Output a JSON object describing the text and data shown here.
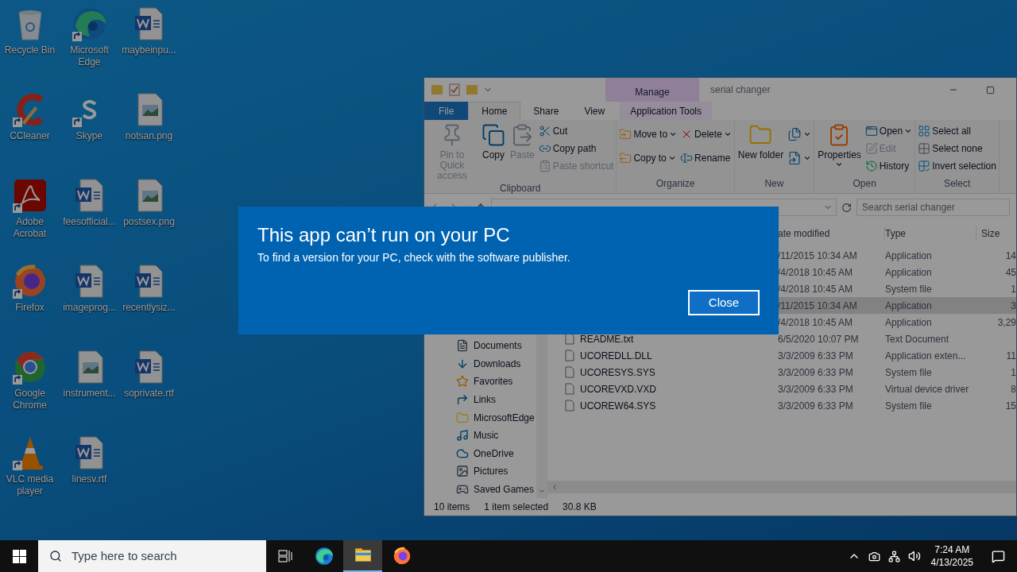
{
  "desktop": {
    "icons": [
      {
        "label": "Recycle Bin",
        "kind": "recycle",
        "shortcut": false
      },
      {
        "label": "CCleaner",
        "kind": "ccleaner",
        "shortcut": true
      },
      {
        "label": "Adobe Acrobat",
        "kind": "acrobat",
        "shortcut": true
      },
      {
        "label": "Firefox",
        "kind": "firefox",
        "shortcut": true
      },
      {
        "label": "Google Chrome",
        "kind": "chrome",
        "shortcut": true
      },
      {
        "label": "VLC media player",
        "kind": "vlc",
        "shortcut": true
      },
      {
        "label": "Microsoft Edge",
        "kind": "edge",
        "shortcut": true
      },
      {
        "label": "Skype",
        "kind": "skype",
        "shortcut": true
      },
      {
        "label": "feesofficial...",
        "kind": "word",
        "shortcut": false
      },
      {
        "label": "imageprog...",
        "kind": "word",
        "shortcut": false
      },
      {
        "label": "instrument...",
        "kind": "image",
        "shortcut": false
      },
      {
        "label": "linesv.rtf",
        "kind": "word",
        "shortcut": false
      },
      {
        "label": "maybeinpu...",
        "kind": "word",
        "shortcut": false
      },
      {
        "label": "notsan.png",
        "kind": "image",
        "shortcut": false
      },
      {
        "label": "postsex.png",
        "kind": "image",
        "shortcut": false
      },
      {
        "label": "recentlysiz...",
        "kind": "word",
        "shortcut": false
      },
      {
        "label": "soprivate.rtf",
        "kind": "word",
        "shortcut": false
      }
    ]
  },
  "explorer": {
    "context_tab": "Manage",
    "title": "serial changer",
    "tabs": [
      {
        "label": "File",
        "kind": "file",
        "selected": false
      },
      {
        "label": "Home",
        "kind": "tab",
        "selected": true
      },
      {
        "label": "Share",
        "kind": "tab",
        "selected": false
      },
      {
        "label": "View",
        "kind": "tab",
        "selected": false
      },
      {
        "label": "Application Tools",
        "kind": "context",
        "selected": false
      }
    ],
    "ribbon": [
      {
        "label": "Clipboard",
        "items": [
          {
            "kind": "large",
            "label": "Pin to Quick access",
            "disabled": true,
            "dropdown": false
          },
          {
            "kind": "large",
            "label": "Copy",
            "disabled": false,
            "dropdown": false
          },
          {
            "kind": "large",
            "label": "Paste",
            "disabled": true,
            "dropdown": false
          },
          {
            "kind": "stack",
            "buttons": [
              {
                "label": "Cut",
                "disabled": false,
                "dropdown": false
              },
              {
                "label": "Copy path",
                "disabled": false,
                "dropdown": false
              },
              {
                "label": "Paste shortcut",
                "disabled": true,
                "dropdown": false
              }
            ]
          }
        ]
      },
      {
        "label": "Organize",
        "items": [
          {
            "kind": "stack",
            "buttons": [
              {
                "label": "Move to",
                "disabled": false,
                "dropdown": true
              },
              {
                "label": "Copy to",
                "disabled": false,
                "dropdown": true
              }
            ]
          },
          {
            "kind": "stack",
            "buttons": [
              {
                "label": "Delete",
                "disabled": false,
                "dropdown": true
              },
              {
                "label": "Rename",
                "disabled": false,
                "dropdown": false
              }
            ]
          }
        ]
      },
      {
        "label": "New",
        "items": [
          {
            "kind": "large",
            "label": "New folder",
            "disabled": false,
            "dropdown": false
          },
          {
            "kind": "stack",
            "buttons": [
              {
                "disabled": false,
                "dropdown": true
              },
              {
                "disabled": false,
                "dropdown": true
              }
            ]
          }
        ]
      },
      {
        "label": "Open",
        "items": [
          {
            "kind": "large",
            "label": "Properties",
            "disabled": false,
            "dropdown": true
          },
          {
            "kind": "stack",
            "buttons": [
              {
                "label": "Open",
                "disabled": false,
                "dropdown": true
              },
              {
                "label": "Edit",
                "disabled": true,
                "dropdown": false
              },
              {
                "label": "History",
                "disabled": false,
                "dropdown": false
              }
            ]
          }
        ]
      },
      {
        "label": "Select",
        "items": [
          {
            "kind": "stack",
            "buttons": [
              {
                "label": "Select all",
                "disabled": false,
                "dropdown": false
              },
              {
                "label": "Select none",
                "disabled": false,
                "dropdown": false
              },
              {
                "label": "Invert selection",
                "disabled": false,
                "dropdown": false
              }
            ]
          }
        ]
      }
    ],
    "search": {
      "placeholder": "Search serial changer"
    },
    "columns": [
      "ate modified",
      "Type",
      "Size"
    ],
    "sidebar": [
      "Documents",
      "Downloads",
      "Favorites",
      "Links",
      "MicrosoftEdge",
      "Music",
      "OneDrive",
      "Pictures",
      "Saved Games"
    ],
    "rows": [
      {
        "date": "/11/2015 10:34 AM",
        "type": "Application",
        "size": "14",
        "selected": false
      },
      {
        "date": "/4/2018 10:45 AM",
        "type": "Application",
        "size": "45",
        "selected": false
      },
      {
        "date": "/4/2018 10:45 AM",
        "type": "System file",
        "size": "1",
        "selected": false
      },
      {
        "date": "/11/2015 10:34 AM",
        "type": "Application",
        "size": "3",
        "selected": true
      },
      {
        "date": "/4/2018 10:45 AM",
        "type": "Application",
        "size": "3,29",
        "selected": false
      },
      {
        "name": "README.txt",
        "date": "6/5/2020 10:07 PM",
        "type": "Text Document",
        "selected": false
      },
      {
        "name": "UCOREDLL.DLL",
        "date": "3/3/2009 6:33 PM",
        "type": "Application exten...",
        "size": "11",
        "selected": false
      },
      {
        "name": "UCORESYS.SYS",
        "date": "3/3/2009 6:33 PM",
        "type": "System file",
        "size": "1",
        "selected": false
      },
      {
        "name": "UCOREVXD.VXD",
        "date": "3/3/2009 6:33 PM",
        "type": "Virtual device driver",
        "size": "8",
        "selected": false
      },
      {
        "name": "UCOREW64.SYS",
        "date": "3/3/2009 6:33 PM",
        "type": "System file",
        "size": "15",
        "selected": false
      }
    ],
    "status_bar": [
      "10 items",
      "1 item selected",
      "30.8 KB"
    ]
  },
  "dialog": {
    "title": "This app can’t run on your PC",
    "message": "To find a version for your PC, check with the software publisher.",
    "button": "Close"
  },
  "taskbar": {
    "search": {
      "placeholder": "Type here to search"
    },
    "apps": [
      {
        "kind": "edge",
        "active": false
      },
      {
        "kind": "explorer",
        "active": true
      },
      {
        "kind": "firefox",
        "active": false
      }
    ],
    "clock": {
      "time": "7:24 AM",
      "date": "4/13/2025"
    }
  }
}
